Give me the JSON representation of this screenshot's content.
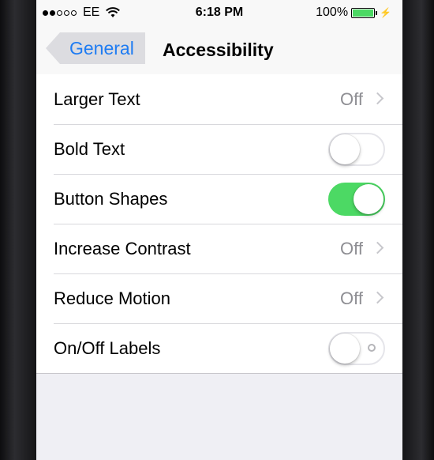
{
  "status_bar": {
    "signal_dots_full": 2,
    "signal_dots_total": 5,
    "carrier": "EE",
    "wifi_icon": "wifi-icon",
    "time": "6:18 PM",
    "battery_percent": "100%",
    "battery_level": 1.0,
    "battery_color": "#4cd964"
  },
  "navbar": {
    "back_label": "General",
    "title": "Accessibility",
    "accent_color": "#1f7cf2"
  },
  "settings": [
    {
      "label": "Larger Text",
      "type": "disclosure",
      "value": "Off"
    },
    {
      "label": "Bold Text",
      "type": "switch",
      "state": "off"
    },
    {
      "label": "Button Shapes",
      "type": "switch",
      "state": "on"
    },
    {
      "label": "Increase Contrast",
      "type": "disclosure",
      "value": "Off"
    },
    {
      "label": "Reduce Motion",
      "type": "disclosure",
      "value": "Off"
    },
    {
      "label": "On/Off Labels",
      "type": "switch",
      "state": "off",
      "shows_off_label": true
    }
  ],
  "switch_on_color": "#4cd964"
}
